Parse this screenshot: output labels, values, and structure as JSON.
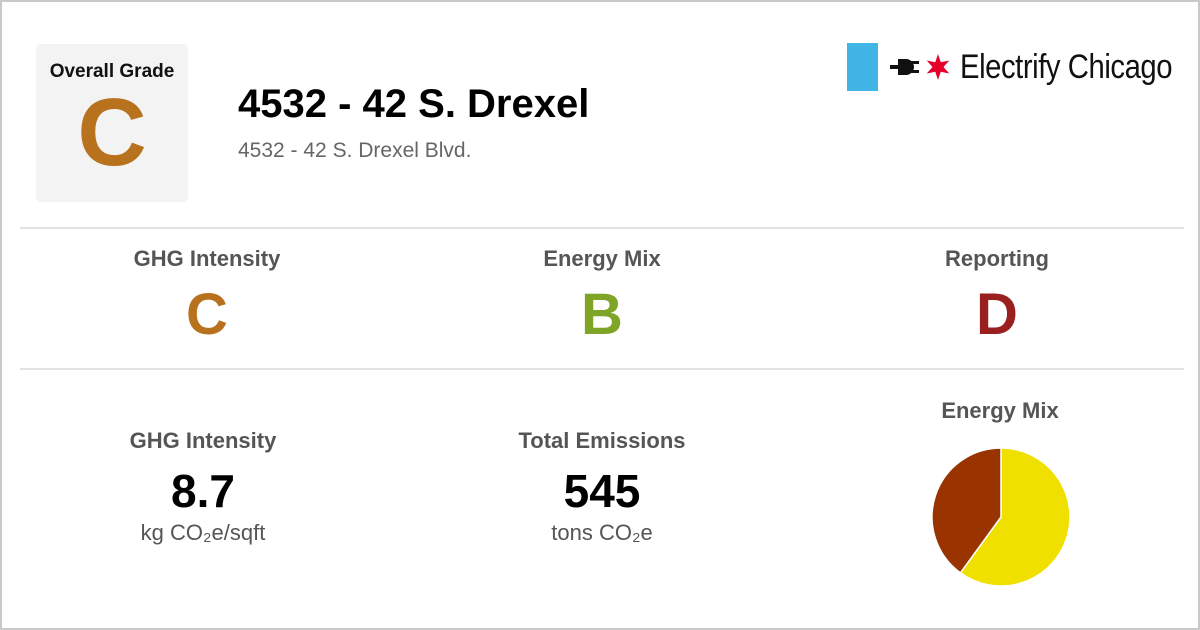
{
  "overall": {
    "label": "Overall Grade",
    "grade": "C",
    "color": "#b8711d"
  },
  "building": {
    "title": "4532 - 42 S. Drexel",
    "address": "4532 - 42 S. Drexel Blvd."
  },
  "brand": {
    "name": "Electrify Chicago",
    "flag_color": "#41b6e6",
    "star_color": "#e4002b"
  },
  "subgrades": [
    {
      "label": "GHG Intensity",
      "grade": "C",
      "color": "#b8711d"
    },
    {
      "label": "Energy Mix",
      "grade": "B",
      "color": "#7ea428"
    },
    {
      "label": "Reporting",
      "grade": "D",
      "color": "#9a2020"
    }
  ],
  "stats": [
    {
      "label": "GHG Intensity",
      "value": "8.7",
      "unit": "kg CO₂e/sqft"
    },
    {
      "label": "Total Emissions",
      "value": "545",
      "unit": "tons CO₂e"
    }
  ],
  "chart_data": {
    "type": "pie",
    "title": "Energy Mix",
    "slices": [
      {
        "name": "",
        "value": 60,
        "color": "#f0e000"
      },
      {
        "name": "",
        "value": 40,
        "color": "#993300"
      }
    ]
  }
}
